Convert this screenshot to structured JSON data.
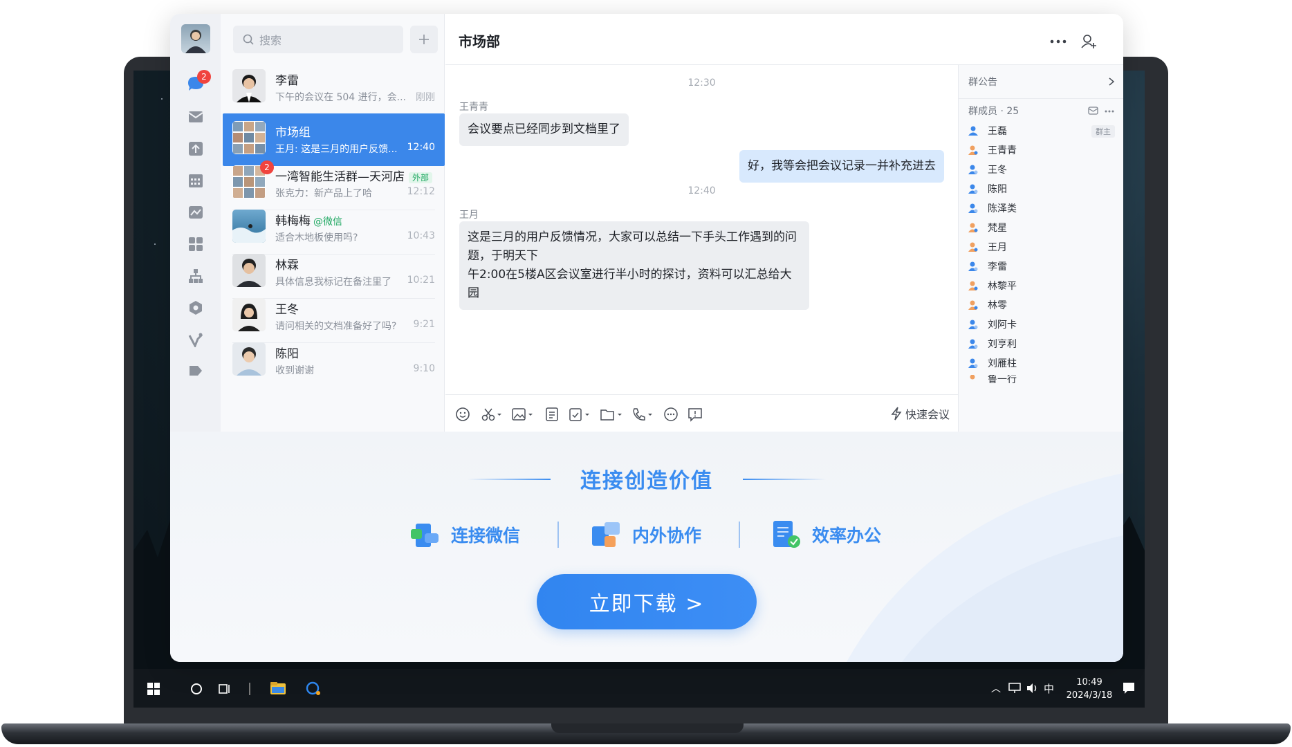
{
  "colors": {
    "accent": "#3b87ea",
    "badge": "#f0443e",
    "green": "#1fa862"
  },
  "nav": {
    "unread_badge": "2",
    "items": [
      "chat-icon",
      "mail-icon",
      "docs-icon",
      "calendar-icon",
      "workbench-icon",
      "apps-icon",
      "org-chart-icon",
      "drive-icon",
      "miniapp-icon",
      "tag-icon"
    ]
  },
  "search": {
    "placeholder": "搜索"
  },
  "conversations": [
    {
      "name": "李雷",
      "preview": "下午的会议在 504 进行，会...",
      "time": "刚刚",
      "badge": "",
      "tag": ""
    },
    {
      "name": "市场组",
      "preview": "王月: 这是三月的用户反馈...",
      "time": "12:40",
      "badge": "",
      "tag": ""
    },
    {
      "name": "一湾智能生活群—天河店",
      "preview": "张克力：新产品上了哈",
      "time": "12:12",
      "badge": "2",
      "tag": "外部"
    },
    {
      "name": "韩梅梅",
      "preview": "适合木地板使用吗?",
      "time": "10:43",
      "badge": "",
      "tag": "@微信"
    },
    {
      "name": "林霖",
      "preview": "具体信息我标记在备注里了",
      "time": "10:21",
      "badge": "",
      "tag": ""
    },
    {
      "name": "王冬",
      "preview": "请问相关的文档准备好了吗?",
      "time": "9:21",
      "badge": "",
      "tag": ""
    },
    {
      "name": "陈阳",
      "preview": "收到谢谢",
      "time": "9:10",
      "badge": "",
      "tag": ""
    }
  ],
  "chat": {
    "title": "市场部",
    "messages": [
      {
        "kind": "time",
        "text": "12:30"
      },
      {
        "kind": "in",
        "sender": "王青青",
        "text": "会议要点已经同步到文档里了"
      },
      {
        "kind": "out",
        "text": "好，我等会把会议记录一并补充进去"
      },
      {
        "kind": "time",
        "text": "12:40"
      },
      {
        "kind": "in",
        "sender": "王月",
        "line1": "这是三月的用户反馈情况，大家可以总结一下手头工作遇到的问题，于明天下",
        "line2": "午2:00在5楼A区会议室进行半小时的探讨，资料可以汇总给大园"
      }
    ],
    "quick_meeting": "快速会议"
  },
  "members_panel": {
    "notice": "群公告",
    "count_label": "群成员 · 25",
    "owner_tag": "群主",
    "members": [
      "王磊",
      "王青青",
      "王冬",
      "陈阳",
      "陈泽类",
      "梵星",
      "王月",
      "李雷",
      "林黎平",
      "林零",
      "刘阿卡",
      "刘亨利",
      "刘雁柱",
      "鲁一行"
    ]
  },
  "promo": {
    "title": "连接创造价值",
    "features": [
      "连接微信",
      "内外协作",
      "效率办公"
    ],
    "download": "立即下载 >"
  },
  "taskbar": {
    "time": "10:49",
    "date": "2024/3/18",
    "ime": "中"
  }
}
